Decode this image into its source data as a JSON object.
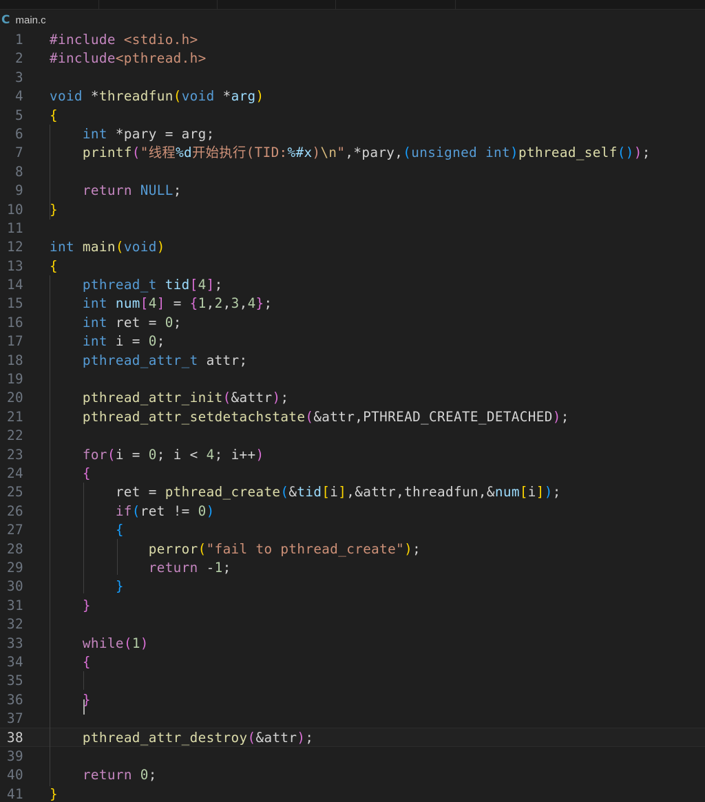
{
  "tab": {
    "icon": "C",
    "filename": "main.c"
  },
  "editor": {
    "current_line": 38,
    "lines": [
      {
        "n": "1",
        "tokens": [
          [
            "pp",
            "#include"
          ],
          [
            "plain",
            " "
          ],
          [
            "str",
            "<stdio.h>"
          ]
        ]
      },
      {
        "n": "2",
        "tokens": [
          [
            "pp",
            "#include"
          ],
          [
            "str",
            "<pthread.h>"
          ]
        ]
      },
      {
        "n": "3",
        "tokens": []
      },
      {
        "n": "4",
        "tokens": [
          [
            "kw",
            "void"
          ],
          [
            "plain",
            " *"
          ],
          [
            "fn",
            "threadfun"
          ],
          [
            "b1",
            "("
          ],
          [
            "kw",
            "void"
          ],
          [
            "plain",
            " *"
          ],
          [
            "var",
            "arg"
          ],
          [
            "b1",
            ")"
          ]
        ]
      },
      {
        "n": "5",
        "tokens": [
          [
            "b1",
            "{"
          ]
        ]
      },
      {
        "n": "6",
        "tokens": [
          [
            "plain",
            "    "
          ],
          [
            "kw",
            "int"
          ],
          [
            "plain",
            " *pary = arg;"
          ]
        ]
      },
      {
        "n": "7",
        "tokens": [
          [
            "plain",
            "    "
          ],
          [
            "fn",
            "printf"
          ],
          [
            "b2",
            "("
          ],
          [
            "str",
            "\"线程"
          ],
          [
            "fmt",
            "%d"
          ],
          [
            "str",
            "开始执行(TID:"
          ],
          [
            "fmt",
            "%#x"
          ],
          [
            "str",
            ")"
          ],
          [
            "esc",
            "\\n"
          ],
          [
            "str",
            "\""
          ],
          [
            "plain",
            ",*pary,"
          ],
          [
            "b3",
            "("
          ],
          [
            "kw",
            "unsigned"
          ],
          [
            "plain",
            " "
          ],
          [
            "kw",
            "int"
          ],
          [
            "b3",
            ")"
          ],
          [
            "fn",
            "pthread_self"
          ],
          [
            "b3",
            "()"
          ],
          [
            "b2",
            ")"
          ],
          [
            "plain",
            ";"
          ]
        ]
      },
      {
        "n": "8",
        "tokens": []
      },
      {
        "n": "9",
        "tokens": [
          [
            "plain",
            "    "
          ],
          [
            "ctl",
            "return"
          ],
          [
            "plain",
            " "
          ],
          [
            "const",
            "NULL"
          ],
          [
            "plain",
            ";"
          ]
        ]
      },
      {
        "n": "10",
        "tokens": [
          [
            "b1",
            "}"
          ]
        ]
      },
      {
        "n": "11",
        "tokens": []
      },
      {
        "n": "12",
        "tokens": [
          [
            "kw",
            "int"
          ],
          [
            "plain",
            " "
          ],
          [
            "fn",
            "main"
          ],
          [
            "b1",
            "("
          ],
          [
            "kw",
            "void"
          ],
          [
            "b1",
            ")"
          ]
        ]
      },
      {
        "n": "13",
        "tokens": [
          [
            "b1",
            "{"
          ]
        ]
      },
      {
        "n": "14",
        "tokens": [
          [
            "plain",
            "    "
          ],
          [
            "kw",
            "pthread_t"
          ],
          [
            "plain",
            " "
          ],
          [
            "var",
            "tid"
          ],
          [
            "b2",
            "["
          ],
          [
            "num",
            "4"
          ],
          [
            "b2",
            "]"
          ],
          [
            "plain",
            ";"
          ]
        ]
      },
      {
        "n": "15",
        "tokens": [
          [
            "plain",
            "    "
          ],
          [
            "kw",
            "int"
          ],
          [
            "plain",
            " "
          ],
          [
            "var",
            "num"
          ],
          [
            "b2",
            "["
          ],
          [
            "num",
            "4"
          ],
          [
            "b2",
            "]"
          ],
          [
            "plain",
            " = "
          ],
          [
            "b2",
            "{"
          ],
          [
            "num",
            "1"
          ],
          [
            "plain",
            ","
          ],
          [
            "num",
            "2"
          ],
          [
            "plain",
            ","
          ],
          [
            "num",
            "3"
          ],
          [
            "plain",
            ","
          ],
          [
            "num",
            "4"
          ],
          [
            "b2",
            "}"
          ],
          [
            "plain",
            ";"
          ]
        ]
      },
      {
        "n": "16",
        "tokens": [
          [
            "plain",
            "    "
          ],
          [
            "kw",
            "int"
          ],
          [
            "plain",
            " ret = "
          ],
          [
            "num",
            "0"
          ],
          [
            "plain",
            ";"
          ]
        ]
      },
      {
        "n": "17",
        "tokens": [
          [
            "plain",
            "    "
          ],
          [
            "kw",
            "int"
          ],
          [
            "plain",
            " i = "
          ],
          [
            "num",
            "0"
          ],
          [
            "plain",
            ";"
          ]
        ]
      },
      {
        "n": "18",
        "tokens": [
          [
            "plain",
            "    "
          ],
          [
            "kw",
            "pthread_attr_t"
          ],
          [
            "plain",
            " attr;"
          ]
        ]
      },
      {
        "n": "19",
        "tokens": []
      },
      {
        "n": "20",
        "tokens": [
          [
            "plain",
            "    "
          ],
          [
            "fn",
            "pthread_attr_init"
          ],
          [
            "b2",
            "("
          ],
          [
            "plain",
            "&attr"
          ],
          [
            "b2",
            ")"
          ],
          [
            "plain",
            ";"
          ]
        ]
      },
      {
        "n": "21",
        "tokens": [
          [
            "plain",
            "    "
          ],
          [
            "fn",
            "pthread_attr_setdetachstate"
          ],
          [
            "b2",
            "("
          ],
          [
            "plain",
            "&attr,PTHREAD_CREATE_DETACHED"
          ],
          [
            "b2",
            ")"
          ],
          [
            "plain",
            ";"
          ]
        ]
      },
      {
        "n": "22",
        "tokens": []
      },
      {
        "n": "23",
        "tokens": [
          [
            "plain",
            "    "
          ],
          [
            "ctl",
            "for"
          ],
          [
            "b2",
            "("
          ],
          [
            "plain",
            "i = "
          ],
          [
            "num",
            "0"
          ],
          [
            "plain",
            "; i < "
          ],
          [
            "num",
            "4"
          ],
          [
            "plain",
            "; i++"
          ],
          [
            "b2",
            ")"
          ]
        ]
      },
      {
        "n": "24",
        "tokens": [
          [
            "plain",
            "    "
          ],
          [
            "b2",
            "{"
          ]
        ]
      },
      {
        "n": "25",
        "tokens": [
          [
            "plain",
            "        ret = "
          ],
          [
            "fn",
            "pthread_create"
          ],
          [
            "b3",
            "("
          ],
          [
            "plain",
            "&"
          ],
          [
            "var",
            "tid"
          ],
          [
            "b1",
            "["
          ],
          [
            "plain",
            "i"
          ],
          [
            "b1",
            "]"
          ],
          [
            "plain",
            ",&attr,threadfun,&"
          ],
          [
            "var",
            "num"
          ],
          [
            "b1",
            "["
          ],
          [
            "plain",
            "i"
          ],
          [
            "b1",
            "]"
          ],
          [
            "b3",
            ")"
          ],
          [
            "plain",
            ";"
          ]
        ]
      },
      {
        "n": "26",
        "tokens": [
          [
            "plain",
            "        "
          ],
          [
            "ctl",
            "if"
          ],
          [
            "b3",
            "("
          ],
          [
            "plain",
            "ret != "
          ],
          [
            "num",
            "0"
          ],
          [
            "b3",
            ")"
          ]
        ]
      },
      {
        "n": "27",
        "tokens": [
          [
            "plain",
            "        "
          ],
          [
            "b3",
            "{"
          ]
        ]
      },
      {
        "n": "28",
        "tokens": [
          [
            "plain",
            "            "
          ],
          [
            "fn",
            "perror"
          ],
          [
            "b1",
            "("
          ],
          [
            "str",
            "\"fail to pthread_create\""
          ],
          [
            "b1",
            ")"
          ],
          [
            "plain",
            ";"
          ]
        ]
      },
      {
        "n": "29",
        "tokens": [
          [
            "plain",
            "            "
          ],
          [
            "ctl",
            "return"
          ],
          [
            "plain",
            " -"
          ],
          [
            "num",
            "1"
          ],
          [
            "plain",
            ";"
          ]
        ]
      },
      {
        "n": "30",
        "tokens": [
          [
            "plain",
            "        "
          ],
          [
            "b3",
            "}"
          ]
        ]
      },
      {
        "n": "31",
        "tokens": [
          [
            "plain",
            "    "
          ],
          [
            "b2",
            "}"
          ]
        ]
      },
      {
        "n": "32",
        "tokens": []
      },
      {
        "n": "33",
        "tokens": [
          [
            "plain",
            "    "
          ],
          [
            "ctl",
            "while"
          ],
          [
            "b2",
            "("
          ],
          [
            "num",
            "1"
          ],
          [
            "b2",
            ")"
          ]
        ]
      },
      {
        "n": "34",
        "tokens": [
          [
            "plain",
            "    "
          ],
          [
            "b2",
            "{"
          ]
        ]
      },
      {
        "n": "35",
        "tokens": []
      },
      {
        "n": "36",
        "tokens": [
          [
            "plain",
            "    "
          ],
          [
            "b2",
            "}"
          ]
        ]
      },
      {
        "n": "37",
        "tokens": []
      },
      {
        "n": "38",
        "tokens": [
          [
            "plain",
            "    "
          ],
          [
            "fn",
            "pthread_attr_destroy"
          ],
          [
            "b2",
            "("
          ],
          [
            "plain",
            "&attr"
          ],
          [
            "b2",
            ")"
          ],
          [
            "plain",
            ";"
          ]
        ]
      },
      {
        "n": "39",
        "tokens": []
      },
      {
        "n": "40",
        "tokens": [
          [
            "plain",
            "    "
          ],
          [
            "ctl",
            "return"
          ],
          [
            "plain",
            " "
          ],
          [
            "num",
            "0"
          ],
          [
            "plain",
            ";"
          ]
        ]
      },
      {
        "n": "41",
        "tokens": [
          [
            "b1",
            "}"
          ]
        ]
      }
    ]
  }
}
